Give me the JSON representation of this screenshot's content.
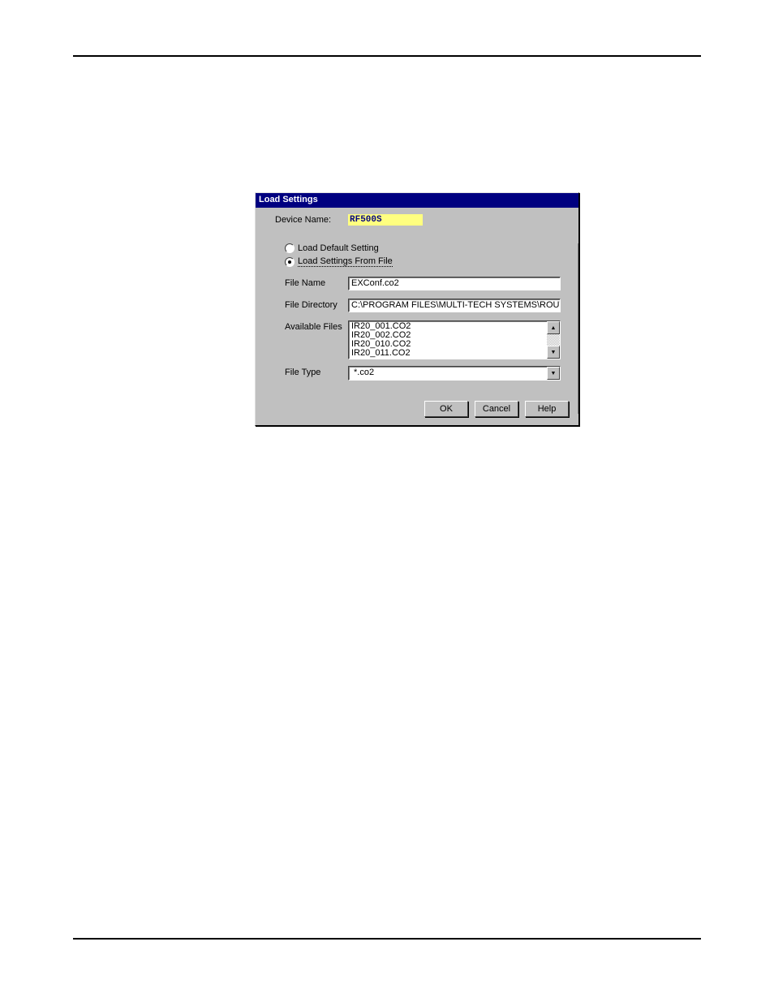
{
  "dialog": {
    "title": "Load Settings",
    "deviceNameLabel": "Device Name:",
    "deviceNameValue": "RF500S",
    "radio": {
      "option1": "Load Default Setting",
      "option2": "Load Settings From File"
    },
    "fileNameLabel": "File Name",
    "fileNameValue": "EXConf.co2",
    "fileDirLabel": "File Directory",
    "fileDirValue": "C:\\PROGRAM FILES\\MULTI-TECH SYSTEMS\\ROUT",
    "availFilesLabel": "Available Files",
    "availFiles": [
      "IR20_001.CO2",
      "IR20_002.CO2",
      "IR20_010.CO2",
      "IR20_011.CO2"
    ],
    "fileTypeLabel": "File Type",
    "fileTypeValue": "*.co2",
    "buttons": {
      "ok": "OK",
      "cancel": "Cancel",
      "help": "Help"
    }
  }
}
